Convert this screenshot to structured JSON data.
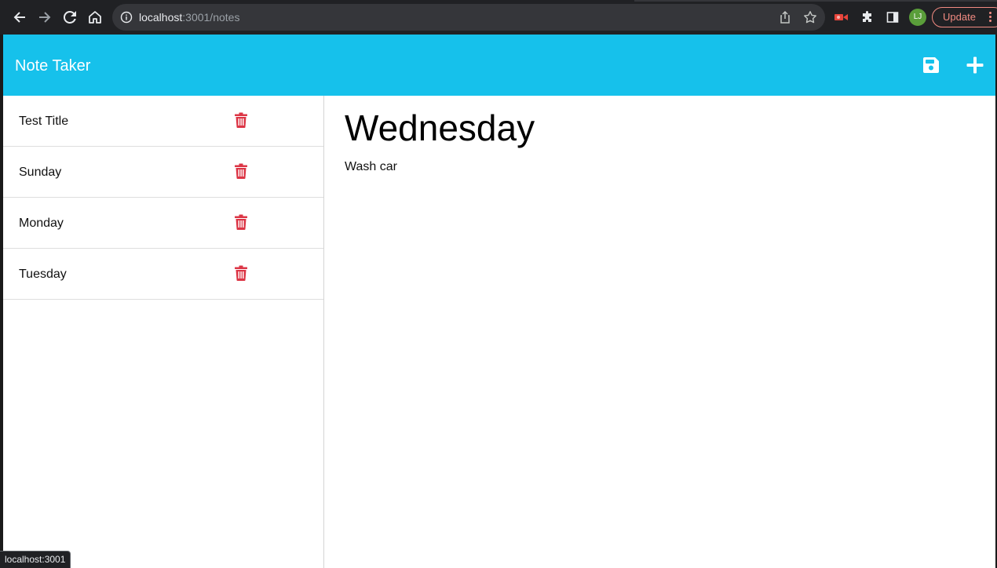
{
  "browser": {
    "url_host": "localhost",
    "url_path": ":3001/notes",
    "avatar_initials": "LJ",
    "update_label": "Update",
    "status_url": "localhost:3001",
    "icons": [
      "back-icon",
      "forward-icon",
      "reload-icon",
      "home-icon",
      "info-icon",
      "share-icon",
      "star-icon",
      "recorder-extension-icon",
      "extensions-puzzle-icon",
      "side-panel-icon",
      "menu-dots-icon"
    ]
  },
  "app": {
    "brand": "Note Taker",
    "accent_color": "#16c1eb",
    "delete_color": "#dc3545",
    "notes": [
      {
        "title": "Test Title"
      },
      {
        "title": "Sunday"
      },
      {
        "title": "Monday"
      },
      {
        "title": "Tuesday"
      }
    ],
    "active_note": {
      "title": "Wednesday",
      "text": "Wash car"
    }
  }
}
